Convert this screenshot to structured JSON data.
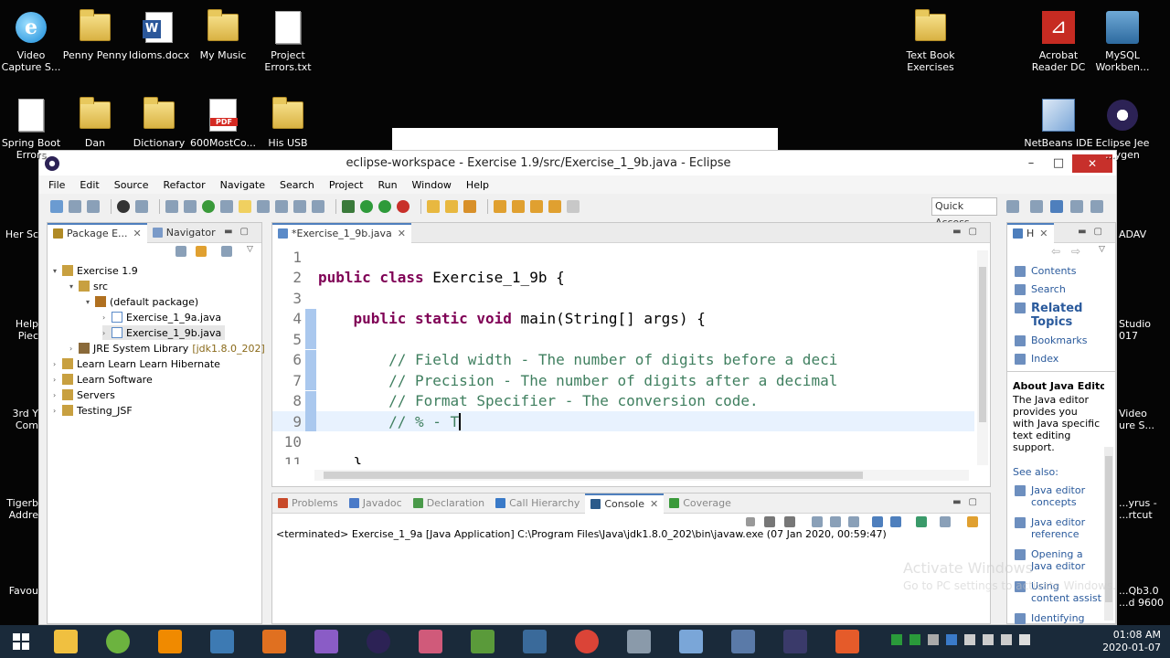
{
  "desktop": {
    "icons_left": [
      {
        "label": "Video\nCapture S...",
        "kind": "ie"
      },
      {
        "label": "Penny Penny",
        "kind": "folder"
      },
      {
        "label": "Idioms.docx",
        "kind": "word"
      },
      {
        "label": "My Music",
        "kind": "folder"
      },
      {
        "label": "Project\nErrors.txt",
        "kind": "doc"
      },
      {
        "label": "Spring Boot\nErrors",
        "kind": "doc"
      },
      {
        "label": "Dan",
        "kind": "folder"
      },
      {
        "label": "Dictionary",
        "kind": "folder"
      },
      {
        "label": "600MostCo...",
        "kind": "pdf"
      },
      {
        "label": "His USB",
        "kind": "folder"
      }
    ],
    "icons_right": [
      {
        "label": "Text Book\nExercises",
        "kind": "folder"
      },
      {
        "label": "Acrobat\nReader DC",
        "kind": "acro"
      },
      {
        "label": "MySQL\nWorkben...",
        "kind": "mysql"
      },
      {
        "label": "NetBeans IDE",
        "kind": "cube"
      },
      {
        "label": "Eclipse Jee\n...ygen",
        "kind": "eclipse"
      }
    ],
    "edge_labels_left": [
      "Her Sc",
      "Help\nPiec",
      "3rd Y\nCom",
      "Tigerb\nAddre",
      "Favou"
    ],
    "edge_labels_right": [
      "ADAV",
      "Studio\n017",
      "Video\nure S...",
      "...yrus -\n...rtcut",
      "...Qb3.0\n...d 9600"
    ],
    "watermark_line1": "Activate Windows",
    "watermark_line2": "Go to PC settings to activate Windows."
  },
  "window": {
    "title": "eclipse-workspace - Exercise 1.9/src/Exercise_1_9b.java - Eclipse",
    "controls": {
      "minimize": "–",
      "maximize": "□",
      "close": "✕"
    }
  },
  "menu": [
    "File",
    "Edit",
    "Source",
    "Refactor",
    "Navigate",
    "Search",
    "Project",
    "Run",
    "Window",
    "Help"
  ],
  "toolbar": {
    "quick_access": "Quick Access"
  },
  "package_explorer": {
    "tabs": [
      {
        "label": "Package E...",
        "active": true
      },
      {
        "label": "Navigator",
        "active": false
      }
    ],
    "tree": [
      {
        "label": "Exercise 1.9",
        "depth": 0,
        "arrow": "▾",
        "icon": "project"
      },
      {
        "label": "src",
        "depth": 1,
        "arrow": "▾",
        "icon": "srcfolder"
      },
      {
        "label": "(default package)",
        "depth": 2,
        "arrow": "▾",
        "icon": "package"
      },
      {
        "label": "Exercise_1_9a.java",
        "depth": 3,
        "arrow": "›",
        "icon": "java"
      },
      {
        "label": "Exercise_1_9b.java",
        "depth": 3,
        "arrow": "›",
        "icon": "java",
        "selected": true
      },
      {
        "label": "JRE System Library",
        "suffix": "[jdk1.8.0_202]",
        "depth": 1,
        "arrow": "›",
        "icon": "library"
      },
      {
        "label": "Learn Learn Learn Hibernate",
        "depth": 0,
        "arrow": "›",
        "icon": "project"
      },
      {
        "label": "Learn Software",
        "depth": 0,
        "arrow": "›",
        "icon": "project"
      },
      {
        "label": "Servers",
        "depth": 0,
        "arrow": "›",
        "icon": "project"
      },
      {
        "label": "Testing_JSF",
        "depth": 0,
        "arrow": "›",
        "icon": "project"
      }
    ]
  },
  "editor": {
    "tab": "*Exercise_1_9b.java",
    "lines": [
      {
        "n": "1",
        "text": ""
      },
      {
        "n": "2",
        "text": "public class Exercise_1_9b {",
        "kw": "public class"
      },
      {
        "n": "3",
        "text": ""
      },
      {
        "n": "4",
        "text": "    public static void main(String[] args) {",
        "kw": "public static void"
      },
      {
        "n": "5",
        "text": ""
      },
      {
        "n": "6",
        "text": "        // Field width - The number of digits before a deci",
        "comment": true
      },
      {
        "n": "7",
        "text": "        // Precision - The number of digits after a decimal",
        "comment": true
      },
      {
        "n": "8",
        "text": "        // Format Specifier - The conversion code.",
        "comment": true
      },
      {
        "n": "9",
        "text": "        // % - T",
        "comment": true,
        "current": true
      },
      {
        "n": "10",
        "text": ""
      },
      {
        "n": "11",
        "text": "    }"
      }
    ]
  },
  "bottom_panel": {
    "tabs": [
      "Problems",
      "Javadoc",
      "Declaration",
      "Call Hierarchy",
      "Console",
      "Coverage"
    ],
    "active_tab": "Console",
    "console_text": "<terminated> Exercise_1_9a [Java Application] C:\\Program Files\\Java\\jdk1.8.0_202\\bin\\javaw.exe (07 Jan 2020, 00:59:47)"
  },
  "help_panel": {
    "tab": "H",
    "items": [
      "Contents",
      "Search"
    ],
    "related": "Related\nTopics",
    "items2": [
      "Bookmarks",
      "Index"
    ],
    "about_title": "About Java Editor",
    "about_text": "The Java editor\nprovides you\nwith Java specific\ntext editing\nsupport.",
    "see_also": "See also:",
    "links": [
      "Java editor\nconcepts",
      "Java editor\nreference",
      "Opening a\nJava editor",
      "Using\ncontent assist",
      "Identifying\nproblems in\nyour code"
    ]
  },
  "taskbar": {
    "time": "01:08 AM",
    "date": "2020-01-07",
    "apps": [
      {
        "name": "file-explorer",
        "color": "#f0c040"
      },
      {
        "name": "spring",
        "color": "#6cb33f"
      },
      {
        "name": "vlc",
        "color": "#f08a00"
      },
      {
        "name": "python",
        "color": "#3d7ab3"
      },
      {
        "name": "media",
        "color": "#e07020"
      },
      {
        "name": "visual-studio",
        "color": "#8a5cc6"
      },
      {
        "name": "eclipse",
        "color": "#2c2255"
      },
      {
        "name": "git-ish",
        "color": "#d05a7a"
      },
      {
        "name": "editor",
        "color": "#5a9a3a"
      },
      {
        "name": "mysql-workbench",
        "color": "#3a6a9a"
      },
      {
        "name": "chrome",
        "color": "#db4437"
      },
      {
        "name": "photos",
        "color": "#8a9aaa"
      },
      {
        "name": "netbeans",
        "color": "#7aa6d8"
      },
      {
        "name": "save-app",
        "color": "#5a7aa8"
      },
      {
        "name": "java-ee",
        "color": "#3a3a6a"
      },
      {
        "name": "office",
        "color": "#e55b2a"
      }
    ]
  }
}
